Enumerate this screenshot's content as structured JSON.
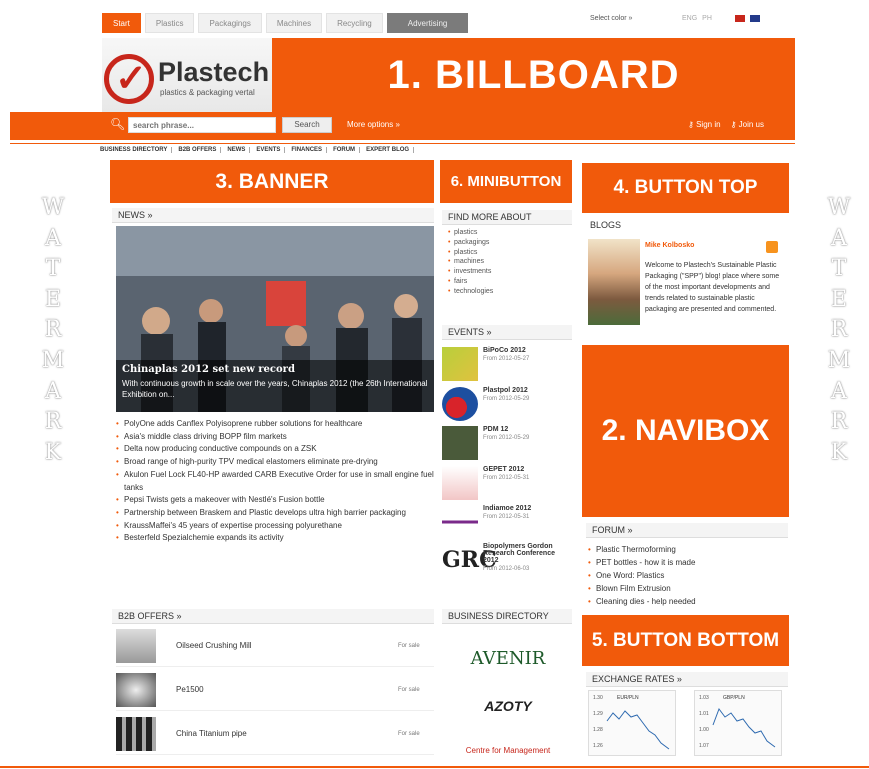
{
  "nav": {
    "tabs": [
      "Start",
      "Plastics",
      "Packagings",
      "Machines",
      "Recycling",
      "Advertising"
    ],
    "select_color": "Select color »",
    "lang_buttons": [
      "ENG",
      "PH"
    ]
  },
  "header": {
    "logo_title": "Plastech",
    "logo_sub": "plastics & packaging vertal",
    "billboard": "1. BILLBOARD"
  },
  "search": {
    "placeholder": "search phrase...",
    "button": "Search",
    "more": "More options »",
    "signin": "Sign in",
    "joinus": "Join us"
  },
  "subnav": [
    "BUSINESS DIRECTORY",
    "B2B OFFERS",
    "NEWS",
    "EVENTS",
    "FINANCES",
    "FORUM",
    "EXPERT BLOG"
  ],
  "watermark": [
    "W",
    "A",
    "T",
    "E",
    "R",
    "M",
    "A",
    "R",
    "K"
  ],
  "banner": {
    "label": "3. BANNER"
  },
  "news": {
    "title": "NEWS »",
    "feature_title": "Chinaplas 2012 set new record",
    "feature_desc": "With continuous growth in scale over the years, Chinaplas 2012 (the 26th International Exhibition on...",
    "items": [
      "PolyOne adds Canflex Polyisoprene rubber solutions for healthcare",
      "Asia's middle class driving BOPP film markets",
      "Delta now producing conductive compounds on a ZSK",
      "Broad range of high-purity TPV medical elastomers eliminate pre-drying",
      "Akulon Fuel Lock FL40-HP awarded CARB Executive Order for use in small engine fuel tanks",
      "Pepsi Twists gets a makeover with Nestlé's Fusion bottle",
      "Partnership between Braskem and Plastic develops ultra high barrier packaging",
      "KraussMaffei's 45 years of expertise processing polyurethane",
      "Besterfeld Spezialchemie expands its activity"
    ]
  },
  "b2b": {
    "title": "B2B OFFERS »",
    "rows": [
      {
        "name": "Oilseed Crushing Mill",
        "tag": "For sale"
      },
      {
        "name": "Pe1500",
        "tag": "For sale"
      },
      {
        "name": "China Titanium pipe",
        "tag": "For sale"
      }
    ]
  },
  "minibutton": {
    "label": "6. MINIBUTTON"
  },
  "findmore": {
    "title": "FIND MORE ABOUT",
    "items": [
      "plastics",
      "packagings",
      "plastics",
      "machines",
      "investments",
      "fairs",
      "technologies"
    ]
  },
  "events": {
    "title": "EVENTS »",
    "items": [
      {
        "name": "BiPoCo 2012",
        "date": "From 2012-05-27"
      },
      {
        "name": "Plastpol 2012",
        "date": "From 2012-05-29"
      },
      {
        "name": "PDM 12",
        "date": "From 2012-05-29"
      },
      {
        "name": "GEPET 2012",
        "date": "From 2012-05-31"
      },
      {
        "name": "Indiamoe 2012",
        "date": "From 2012-05-31"
      },
      {
        "name": "Biopolymers Gordon Research Conference 2012",
        "date": "From 2012-06-03"
      }
    ]
  },
  "business_dir": {
    "title": "BUSINESS DIRECTORY",
    "logos": [
      "AVENIR",
      "AZOTY",
      "Centre for Management"
    ]
  },
  "button_top": {
    "label": "4. BUTTON TOP"
  },
  "blogs": {
    "title": "BLOGS",
    "author": "Mike Kolbosko",
    "text": "Welcome to Plastech's Sustainable Plastic Packaging (\"SPP\") blog! place where some of the most important developments and trends related to sustainable plastic packaging are presented and commented."
  },
  "navibox": {
    "label": "2. NAVIBOX"
  },
  "forum": {
    "title": "FORUM »",
    "items": [
      "Plastic Thermoforming",
      "PET bottles - how it is made",
      "One Word: Plastics",
      "Blown Film Extrusion",
      "Cleaning dies - help needed"
    ]
  },
  "button_bottom": {
    "label": "5. BUTTON BOTTOM"
  },
  "exchange": {
    "title": "EXCHANGE RATES »",
    "charts": [
      {
        "name": "EUR/PLN",
        "ticks": [
          "1.30",
          "1.29",
          "1.28",
          "1.26"
        ]
      },
      {
        "name": "GBP/PLN",
        "ticks": [
          "1.03",
          "1.01",
          "1.00",
          "1.07"
        ]
      }
    ]
  },
  "colors": {
    "accent": "#f15a0b",
    "logo_red": "#c7261b"
  }
}
